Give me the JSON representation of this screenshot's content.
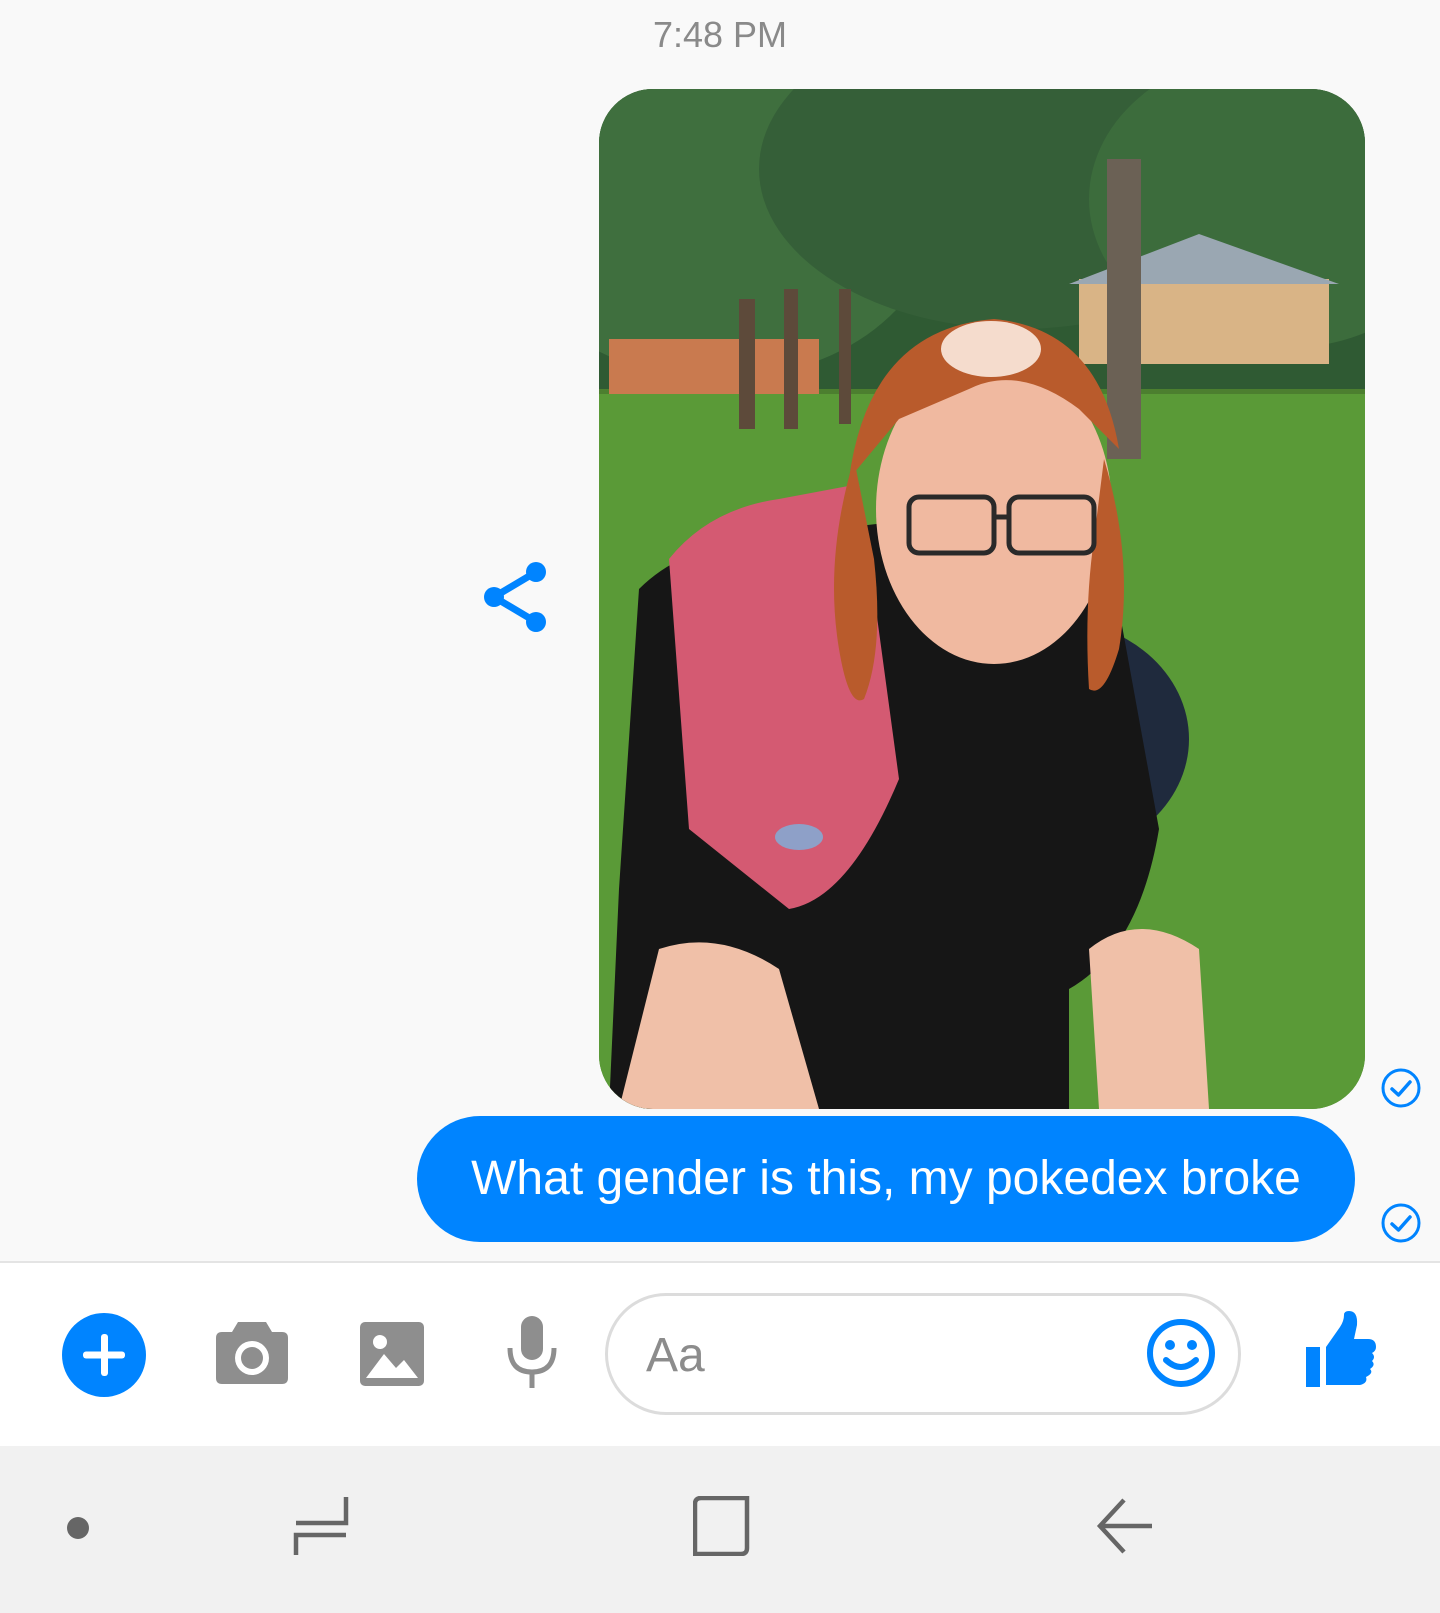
{
  "thread": {
    "timestamp": "7:48 PM",
    "message_text": "What gender is this, my pokedex broke"
  },
  "composer": {
    "placeholder": "Aa"
  },
  "icons": {
    "share": "share-icon",
    "receipt": "check-circle-icon",
    "add": "plus-icon",
    "camera": "camera-icon",
    "gallery": "image-icon",
    "mic": "microphone-icon",
    "emoji": "smiley-icon",
    "like": "thumbs-up-icon",
    "nav_recents": "recents-icon",
    "nav_home": "home-icon",
    "nav_back": "back-arrow-icon"
  },
  "colors": {
    "accent": "#0084ff",
    "icon_gray": "#8e8e8e",
    "timestamp": "#8a8a8a"
  }
}
